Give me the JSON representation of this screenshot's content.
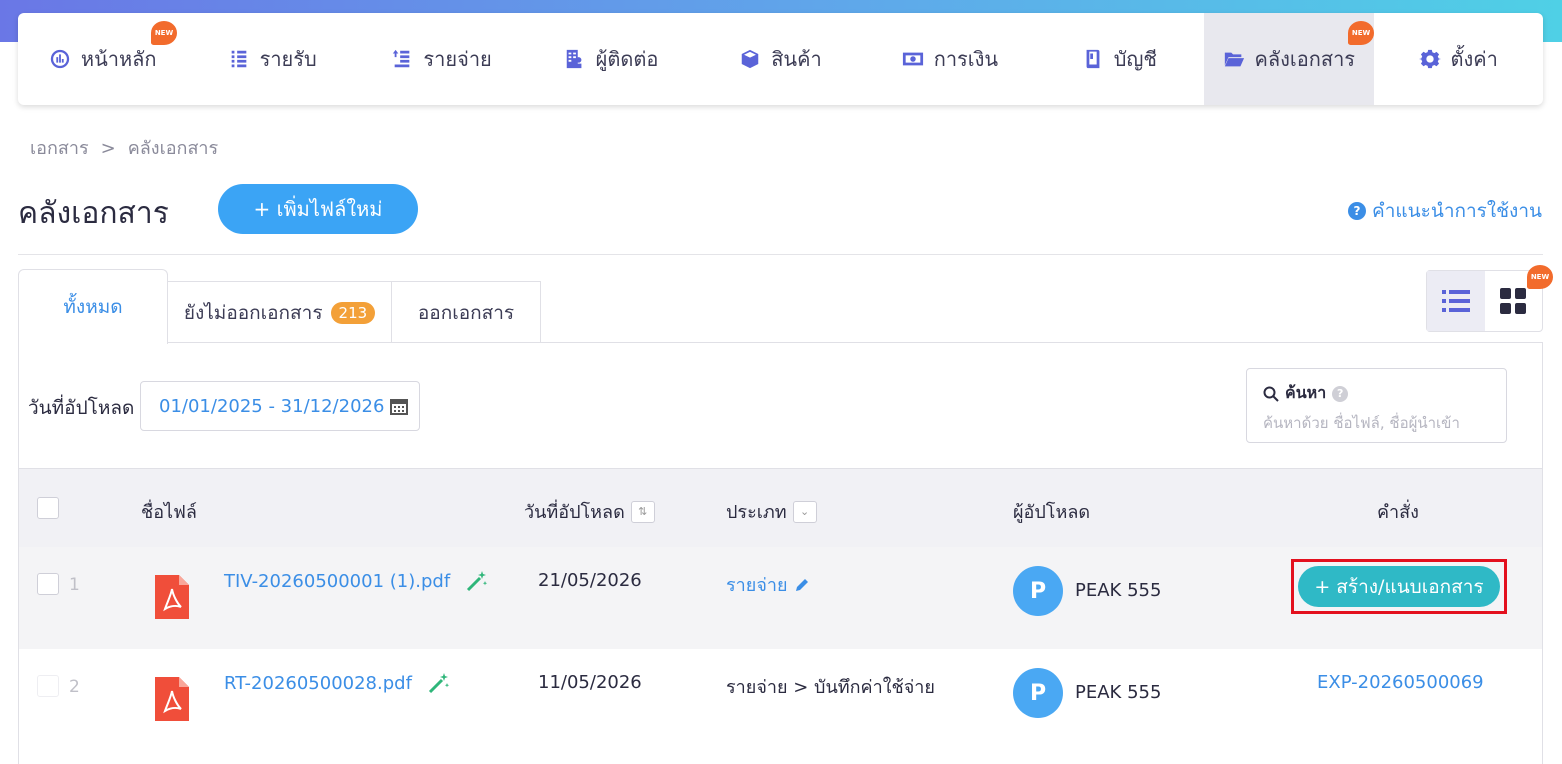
{
  "nav": {
    "items": [
      {
        "label": "หน้าหลัก",
        "icon": "dashboard-icon",
        "new": true
      },
      {
        "label": "รายรับ",
        "icon": "income-icon",
        "new": false
      },
      {
        "label": "รายจ่าย",
        "icon": "expense-icon",
        "new": false
      },
      {
        "label": "ผู้ติดต่อ",
        "icon": "contacts-icon",
        "new": false
      },
      {
        "label": "สินค้า",
        "icon": "product-box-icon",
        "new": false
      },
      {
        "label": "การเงิน",
        "icon": "money-icon",
        "new": false
      },
      {
        "label": "บัญชี",
        "icon": "book-icon",
        "new": false
      },
      {
        "label": "คลังเอกสาร",
        "icon": "folder-open-icon",
        "new": true,
        "active": true
      },
      {
        "label": "ตั้งค่า",
        "icon": "gear-icon",
        "new": false
      }
    ],
    "new_badge": "NEW"
  },
  "breadcrumb": {
    "items": [
      "เอกสาร",
      "คลังเอกสาร"
    ],
    "separator": ">"
  },
  "page": {
    "title": "คลังเอกสาร",
    "add_button": "+ เพิ่มไฟล์ใหม่",
    "help_link": "คำแนะนำการใช้งาน"
  },
  "tabs": [
    {
      "label": "ทั้งหมด",
      "active": true
    },
    {
      "label": "ยังไม่ออกเอกสาร",
      "count": "213"
    },
    {
      "label": "ออกเอกสาร"
    }
  ],
  "view_toggle": {
    "new_badge": "NEW",
    "active": "list"
  },
  "filter": {
    "date_label": "วันที่อัปโหลด",
    "date_range": "01/01/2025 - 31/12/2026"
  },
  "search": {
    "title": "ค้นหา",
    "placeholder": "ค้นหาด้วย ชื่อไฟล์, ชื่อผู้นำเข้า"
  },
  "table": {
    "columns": {
      "file_name": "ชื่อไฟล์",
      "upload_date": "วันที่อัปโหลด",
      "type": "ประเภท",
      "uploader": "ผู้อัปโหลด",
      "command": "คำสั่ง"
    },
    "rows": [
      {
        "num": "1",
        "file": "TIV-20260500001 (1).pdf",
        "date": "21/05/2026",
        "type": "รายจ่าย",
        "avatar": "P",
        "uploader": "PEAK 555",
        "command": "+ สร้าง/แนบเอกสาร"
      },
      {
        "num": "2",
        "file": "RT-20260500028.pdf",
        "date": "11/05/2026",
        "type": "รายจ่าย > บันทึกค่าใช้จ่าย",
        "avatar": "P",
        "uploader": "PEAK 555",
        "command": "EXP-20260500069"
      }
    ]
  },
  "colors": {
    "accent": "#3b8ee6",
    "primary_button": "#3ba4f5",
    "create_button": "#2fb9c6",
    "highlight_border": "#e3101e",
    "badge_orange": "#f3a038",
    "new_badge": "#f26b2c"
  }
}
